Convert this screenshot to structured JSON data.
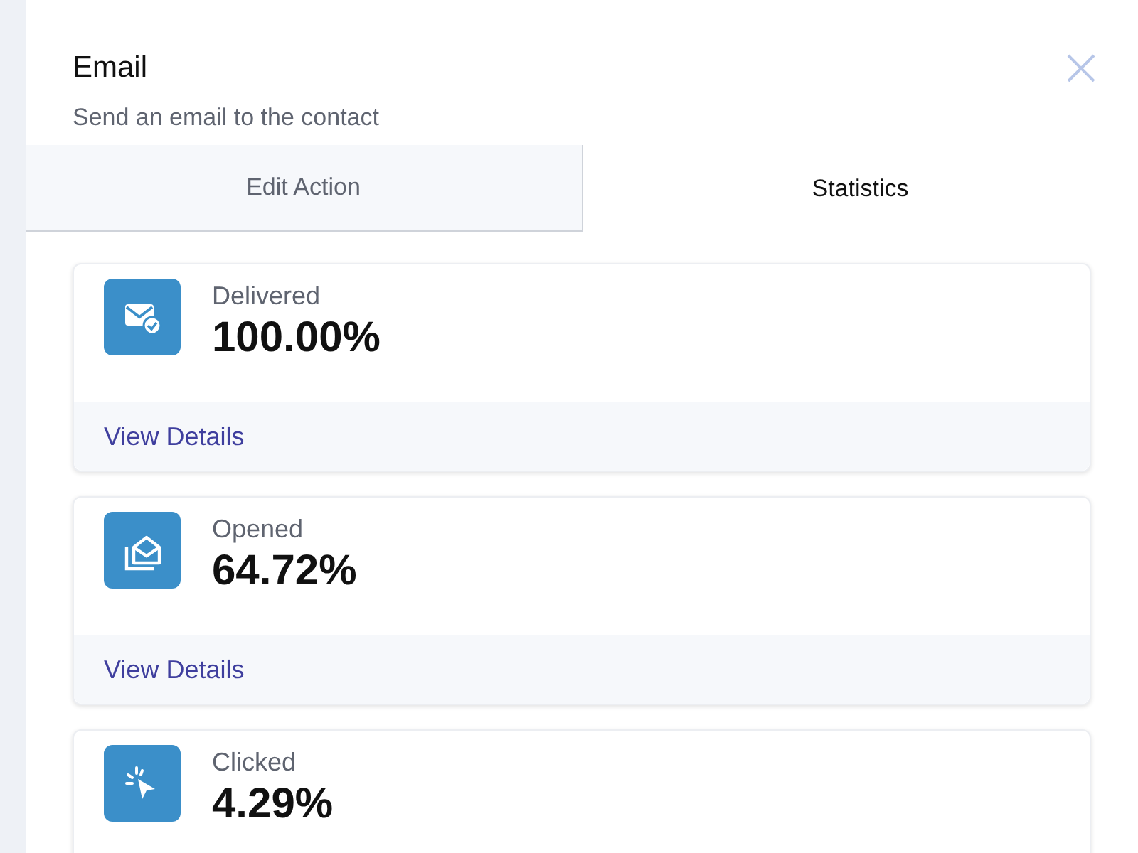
{
  "header": {
    "title": "Email",
    "subtitle": "Send an email to the contact"
  },
  "tabs": [
    {
      "label": "Edit Action",
      "selected": false
    },
    {
      "label": "Statistics",
      "selected": true
    }
  ],
  "stats": [
    {
      "kind": "delivered",
      "label": "Delivered",
      "value": "100.00%",
      "link": "View Details"
    },
    {
      "kind": "opened",
      "label": "Opened",
      "value": "64.72%",
      "link": "View Details"
    },
    {
      "kind": "clicked",
      "label": "Clicked",
      "value": "4.29%"
    }
  ]
}
